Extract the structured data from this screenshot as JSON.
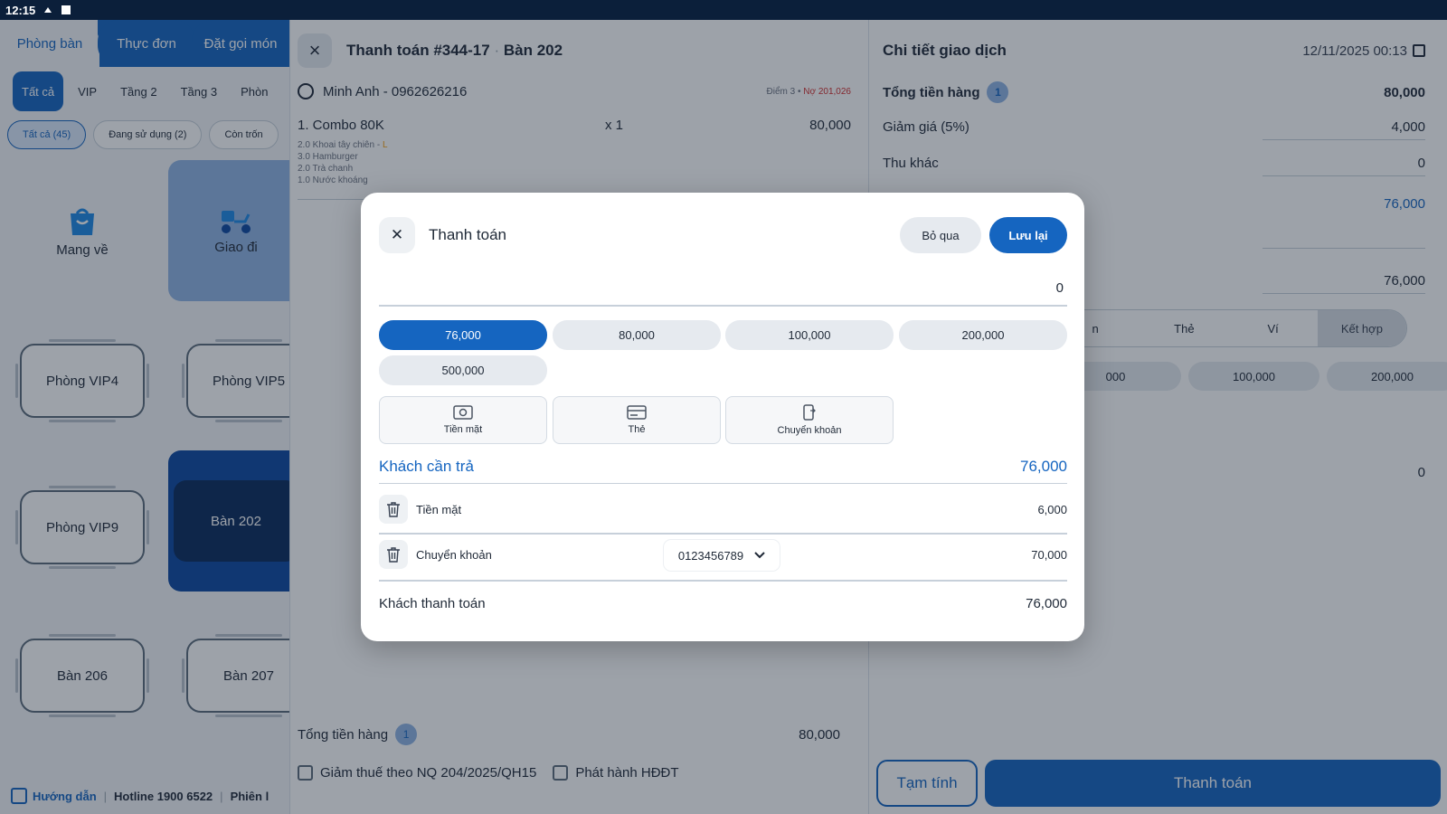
{
  "status_bar": {
    "time": "12:15"
  },
  "left": {
    "tabs": [
      "Phòng bàn",
      "Thực đơn",
      "Đặt gọi món"
    ],
    "floors": [
      "Tất cả",
      "VIP",
      "Tầng 2",
      "Tầng 3",
      "Phòn"
    ],
    "filters": [
      "Tất cả (45)",
      "Đang sử dụng (2)",
      "Còn trốn"
    ],
    "tiles": {
      "takeaway": "Mang về",
      "delivery": "Giao đi"
    },
    "rooms": [
      "Phòng VIP4",
      "Phòng VIP5",
      "Phòng VIP9",
      "Bàn 202",
      "Bàn 206",
      "Bàn 207"
    ],
    "footer": {
      "guide": "Hướng dẫn",
      "hotline": "Hotline 1900 6522",
      "session": "Phiên l"
    }
  },
  "middle": {
    "title": "Thanh toán #344-17",
    "table": "Bàn 202",
    "customer": "Minh Anh - 0962626216",
    "points": "Điểm 3",
    "debt": "Nợ 201,026",
    "item": {
      "name": "1. Combo 80K",
      "qty": "x 1",
      "price": "80,000"
    },
    "sub_items": [
      "2.0 Khoai tây chiên - ",
      "3.0 Hamburger",
      "2.0 Trà chanh",
      "1.0 Nước khoáng"
    ],
    "sub_item_tag": "L",
    "total_label": "Tổng tiền hàng",
    "total_count": "1",
    "total_value": "80,000",
    "tax_check": "Giảm thuế theo NQ 204/2025/QH15",
    "einvoice_check": "Phát hành HĐĐT"
  },
  "right": {
    "title": "Chi tiết giao dịch",
    "date": "12/11/2025 00:13",
    "subtotal_label": "Tổng tiền hàng",
    "subtotal_count": "1",
    "subtotal": "80,000",
    "discount_label": "Giảm giá (5%)",
    "discount": "4,000",
    "other_label": "Thu khác",
    "other": "0",
    "due": "76,000",
    "paid": "76,000",
    "methods": [
      "n",
      "Thẻ",
      "Ví",
      "Kết hợp"
    ],
    "amounts": [
      "000",
      "100,000",
      "200,000"
    ],
    "change": "0",
    "temp_button": "Tạm tính",
    "pay_button": "Thanh toán"
  },
  "modal": {
    "title": "Thanh toán",
    "skip": "Bỏ qua",
    "save": "Lưu lại",
    "input_value": "0",
    "quick_amounts": [
      "76,000",
      "80,000",
      "100,000",
      "200,000",
      "500,000"
    ],
    "methods": [
      "Tiền mặt",
      "Thẻ",
      "Chuyển khoản"
    ],
    "due_label": "Khách cần trả",
    "due_value": "76,000",
    "lines": [
      {
        "label": "Tiền mặt",
        "value": "6,000"
      },
      {
        "label": "Chuyển khoản",
        "account": "0123456789",
        "value": "70,000"
      }
    ],
    "paid_label": "Khách thanh toán",
    "paid_value": "76,000"
  }
}
